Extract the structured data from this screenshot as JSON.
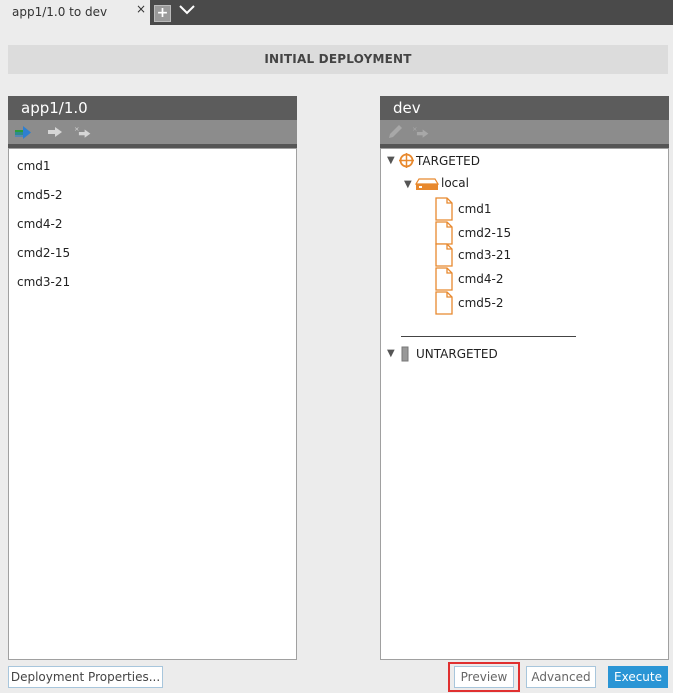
{
  "tab": {
    "label": "app1/1.0 to dev",
    "close_symbol": "×",
    "add_symbol": "+"
  },
  "section_title": "INITIAL DEPLOYMENT",
  "left_panel": {
    "title": "app1/1.0",
    "items": [
      "cmd1",
      "cmd5-2",
      "cmd4-2",
      "cmd2-15",
      "cmd3-21"
    ]
  },
  "right_panel": {
    "title": "dev",
    "targeted_label": "TARGETED",
    "server_label": "local",
    "files": [
      "cmd1",
      "cmd2-15",
      "cmd3-21",
      "cmd4-2",
      "cmd5-2"
    ],
    "separator": "___________________________",
    "untargeted_label": "UNTARGETED"
  },
  "buttons": {
    "deployment_properties": "Deployment Properties...",
    "preview": "Preview",
    "advanced": "Advanced",
    "execute": "Execute"
  },
  "colors": {
    "accent": "#2a95d5",
    "target_orange": "#e8892e",
    "highlight_red": "#e03030"
  }
}
